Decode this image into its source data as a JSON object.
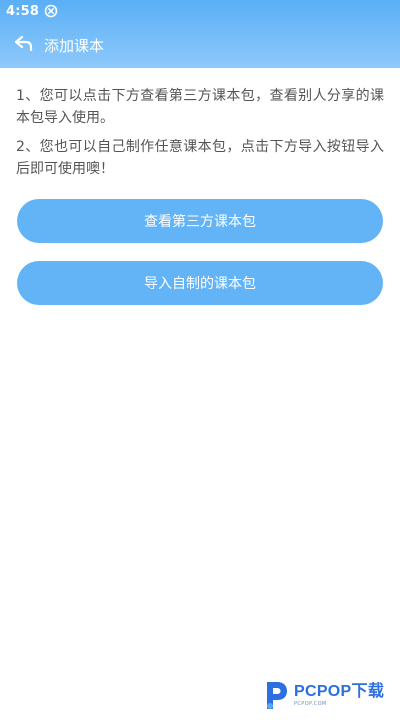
{
  "status_bar": {
    "time": "4:58",
    "notification_icon": "close-circle-icon"
  },
  "app_bar": {
    "back_icon": "back-arrow-icon",
    "title": "添加课本"
  },
  "instructions": [
    "1、您可以点击下方查看第三方课本包，查看别人分享的课本包导入使用。",
    "2、您也可以自己制作任意课本包，点击下方导入按钮导入后即可使用噢！"
  ],
  "buttons": {
    "view_third_party": "查看第三方课本包",
    "import_custom": "导入自制的课本包"
  },
  "watermark": {
    "logo_icon": "pcpop-logo-icon",
    "text": "PCPOP下载",
    "subtext": "PCPOP.COM"
  },
  "colors": {
    "header_top": "#5aaff6",
    "header_bottom": "#8ec9fb",
    "button": "#63b3f7",
    "text": "#555555",
    "watermark": "#2b6fe0"
  }
}
